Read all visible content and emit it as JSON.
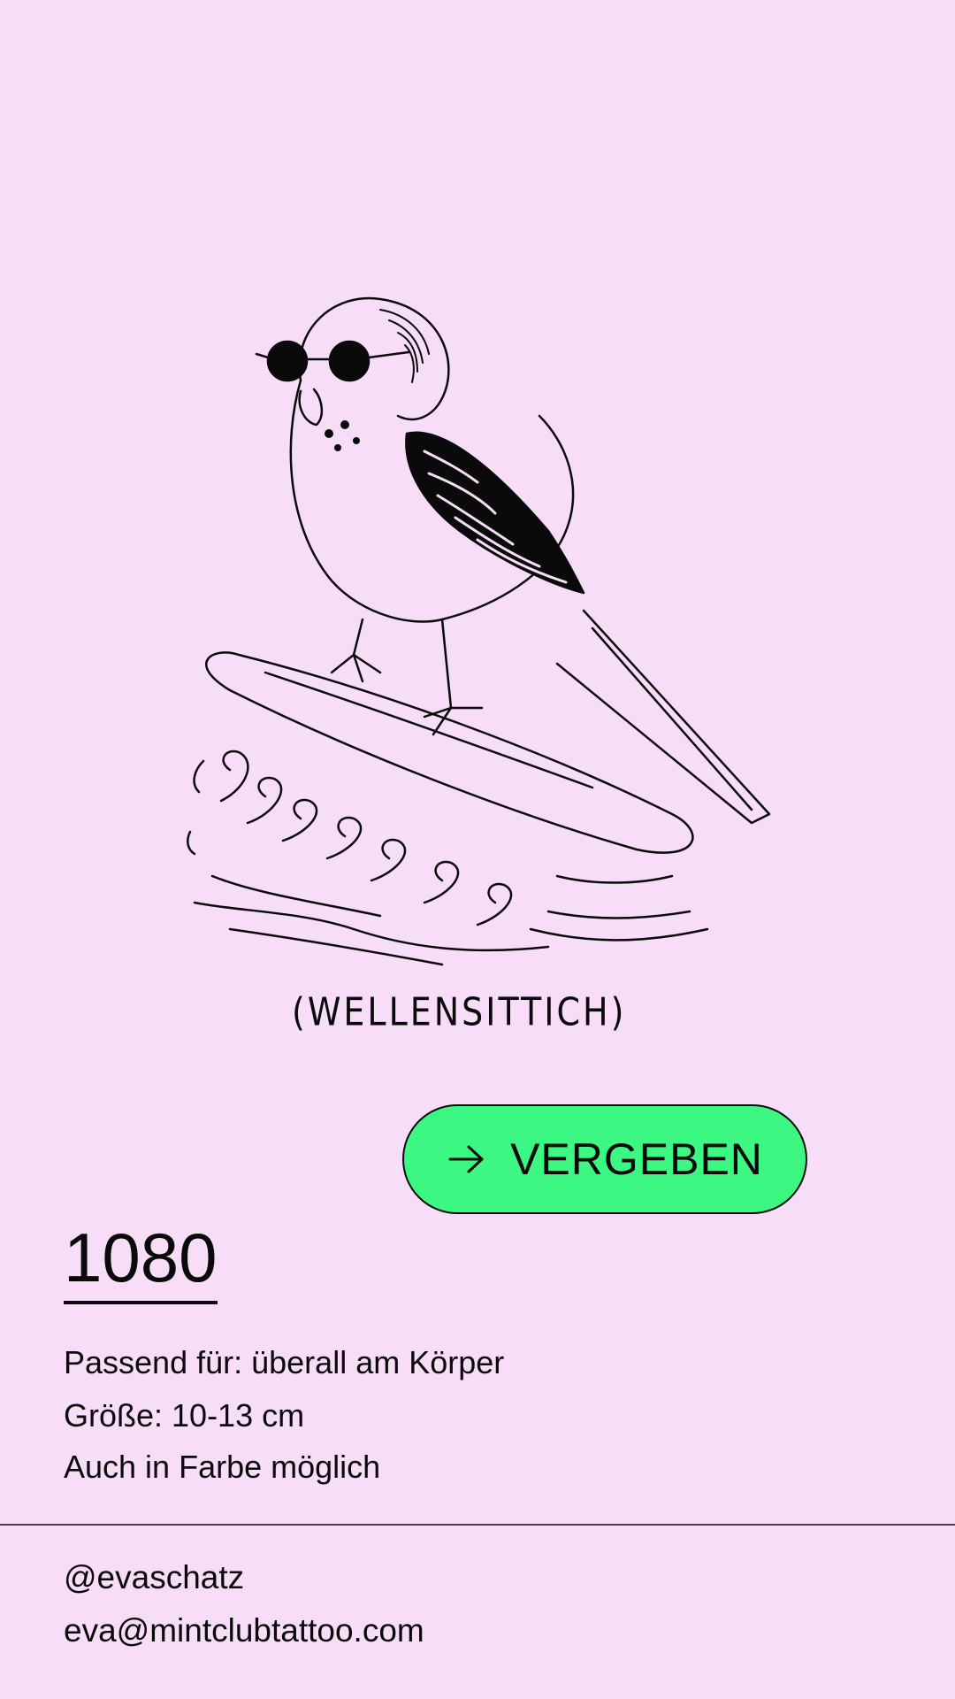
{
  "artwork": {
    "icon": "budgie-surfing-sunglasses-illustration",
    "caption": "(WELLENSITTICH)"
  },
  "status_button": {
    "icon": "arrow-right-icon",
    "label": "VERGEBEN",
    "color": "#3df783"
  },
  "design": {
    "number": "1080",
    "details": [
      "Passend für: überall am Körper",
      "Größe: 10-13 cm",
      "Auch in Farbe möglich"
    ]
  },
  "contact": {
    "handle": "@evaschatz",
    "email": "eva@mintclubtattoo.com"
  },
  "colors": {
    "background": "#f8ddf8",
    "ink": "#0a0a0a",
    "accent": "#3df783"
  }
}
